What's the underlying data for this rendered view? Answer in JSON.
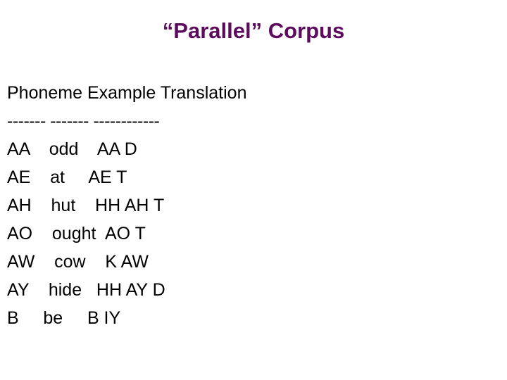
{
  "slide": {
    "title": "“Parallel” Corpus",
    "title_color": "#5d0b5d",
    "body_color": "#000000",
    "background_color": "#ffffff"
  },
  "table": {
    "header_line": "Phoneme Example Translation",
    "separator_line": "------- ------- ------------",
    "columns": [
      "Phoneme",
      "Example",
      "Translation"
    ],
    "rows": [
      {
        "phoneme": "AA",
        "example": "odd",
        "translation": "AA D",
        "line": "AA    odd    AA D"
      },
      {
        "phoneme": "AE",
        "example": "at",
        "translation": "AE T",
        "line": "AE    at     AE T"
      },
      {
        "phoneme": "AH",
        "example": "hut",
        "translation": "HH AH T",
        "line": "AH    hut    HH AH T"
      },
      {
        "phoneme": "AO",
        "example": "ought",
        "translation": "AO T",
        "line": "AO    ought  AO T"
      },
      {
        "phoneme": "AW",
        "example": "cow",
        "translation": "K AW",
        "line": "AW    cow    K AW"
      },
      {
        "phoneme": "AY",
        "example": "hide",
        "translation": "HH AY D",
        "line": "AY    hide   HH AY D"
      },
      {
        "phoneme": "B",
        "example": "be",
        "translation": "B IY",
        "line": "B     be     B IY"
      }
    ]
  }
}
